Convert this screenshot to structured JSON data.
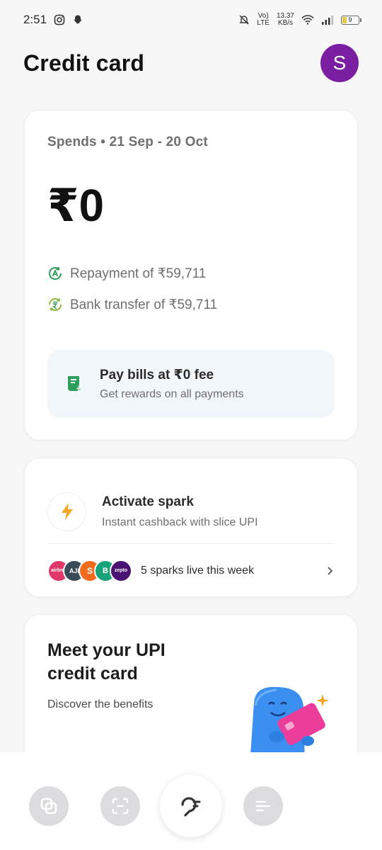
{
  "status_bar": {
    "time": "2:51",
    "speed_value": "13.37",
    "speed_unit": "KB/s",
    "battery": "9",
    "network_label_1": "Vo)",
    "network_label_2": "LTE"
  },
  "header": {
    "title": "Credit card",
    "avatar_initial": "S",
    "avatar_color": "#7b1fa2"
  },
  "spends": {
    "label": "Spends • 21 Sep - 20 Oct",
    "amount": "₹0",
    "repayment": "Repayment of ₹59,711",
    "bank_transfer": "Bank transfer of ₹59,711",
    "bills_title": "Pay bills at ₹0 fee",
    "bills_subtitle": "Get rewards on all payments"
  },
  "spark": {
    "title": "Activate spark",
    "subtitle": "Instant cashback with slice UPI",
    "live_text": "5 sparks live this week",
    "brand_logos": [
      {
        "label": "airbnb",
        "color": "#e0386b"
      },
      {
        "label": "AJI",
        "color": "#3b4a5a"
      },
      {
        "label": "S",
        "color": "#f26b1d"
      },
      {
        "label": "B",
        "color": "#1aa37a"
      },
      {
        "label": "zepto",
        "color": "#4a1273"
      }
    ]
  },
  "upi": {
    "title": "Meet your UPI credit card",
    "subtitle": "Discover the benefits"
  },
  "colors": {
    "accent_green": "#2e9e5b",
    "spark_orange": "#f5a623"
  },
  "nav": {
    "items": [
      "cards-icon",
      "scan-icon",
      "slice-home-icon",
      "menu-icon"
    ]
  }
}
